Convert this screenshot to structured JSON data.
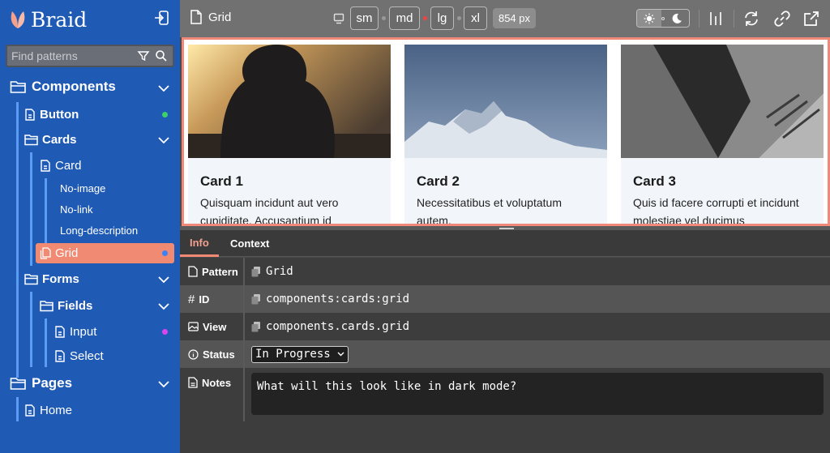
{
  "app": {
    "name": "Braid"
  },
  "sidebar": {
    "search_placeholder": "Find patterns",
    "items": {
      "components": "Components",
      "button": "Button",
      "cards": "Cards",
      "card": "Card",
      "no_image": "No-image",
      "no_link": "No-link",
      "long_description": "Long-description",
      "grid": "Grid",
      "forms": "Forms",
      "fields": "Fields",
      "input": "Input",
      "select": "Select",
      "pages": "Pages",
      "home": "Home"
    },
    "status_colors": {
      "button": "#3ecf6b",
      "grid": "#3b82f6",
      "input": "#d946ef"
    }
  },
  "toolbar": {
    "title": "Grid",
    "breakpoints": [
      "sm",
      "md",
      "lg",
      "xl"
    ],
    "width_badge": "854 px",
    "active_indicator_color": "#ef4444"
  },
  "preview": {
    "cards": [
      {
        "title": "Card 1",
        "text": "Quisquam incidunt aut vero cupiditate. Accusantium id"
      },
      {
        "title": "Card 2",
        "text": "Necessitatibus et voluptatum autem."
      },
      {
        "title": "Card 3",
        "text": "Quis id facere corrupti et incidunt molestiae vel ducimus"
      }
    ]
  },
  "info": {
    "tabs": [
      "Info",
      "Context"
    ],
    "rows": {
      "pattern_label": "Pattern",
      "pattern_value": "Grid",
      "id_label": "ID",
      "id_value": "components:cards:grid",
      "view_label": "View",
      "view_value": "components.cards.grid",
      "status_label": "Status",
      "status_value": "In Progress",
      "notes_label": "Notes",
      "notes_value": "What will this look like in dark mode?"
    }
  },
  "colors": {
    "accent": "#f08a73",
    "sidebar": "#1f5ab5"
  }
}
